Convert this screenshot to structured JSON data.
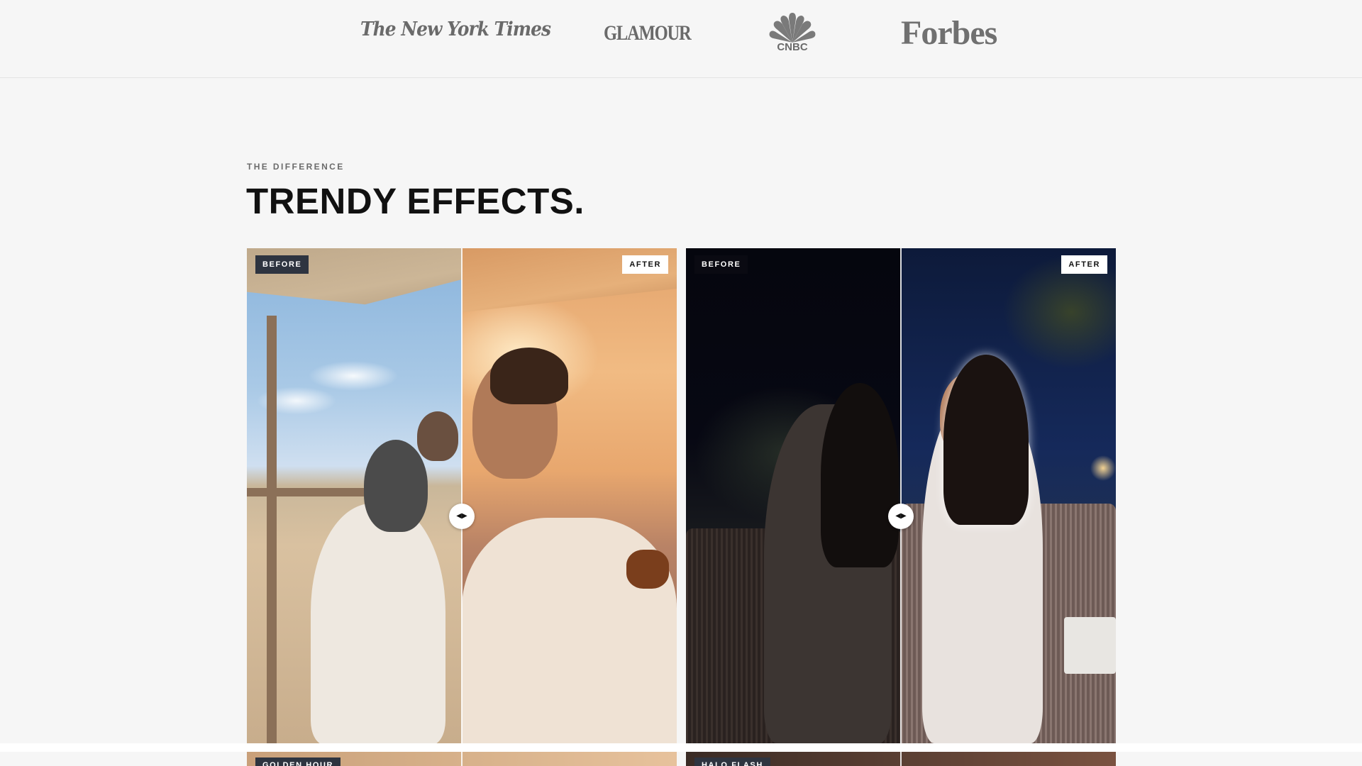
{
  "press": {
    "logos": [
      {
        "name": "The New York Times",
        "text": "The New York Times"
      },
      {
        "name": "Glamour",
        "text": "GLAMOUR"
      },
      {
        "name": "CNBC",
        "text": "CNBC",
        "icon": "peacock-icon"
      },
      {
        "name": "Forbes",
        "text": "Forbes"
      }
    ]
  },
  "section": {
    "eyebrow": "THE DIFFERENCE",
    "title": "TRENDY EFFECTS."
  },
  "cards": [
    {
      "effect": "GOLDEN HOUR",
      "before_label": "BEFORE",
      "after_label": "AFTER",
      "slider_position_percent": 50
    },
    {
      "effect": "HALO FLASH",
      "before_label": "BEFORE",
      "after_label": "AFTER",
      "slider_position_percent": 50
    }
  ],
  "next_row": {
    "labels": [
      "GOLDEN HOUR",
      "HALO FLASH"
    ]
  },
  "colors": {
    "background": "#f6f6f6",
    "text": "#111111",
    "logo_gray": "#6a6a6a",
    "badge_dark": "#2e3440",
    "badge_light": "#ffffff"
  }
}
